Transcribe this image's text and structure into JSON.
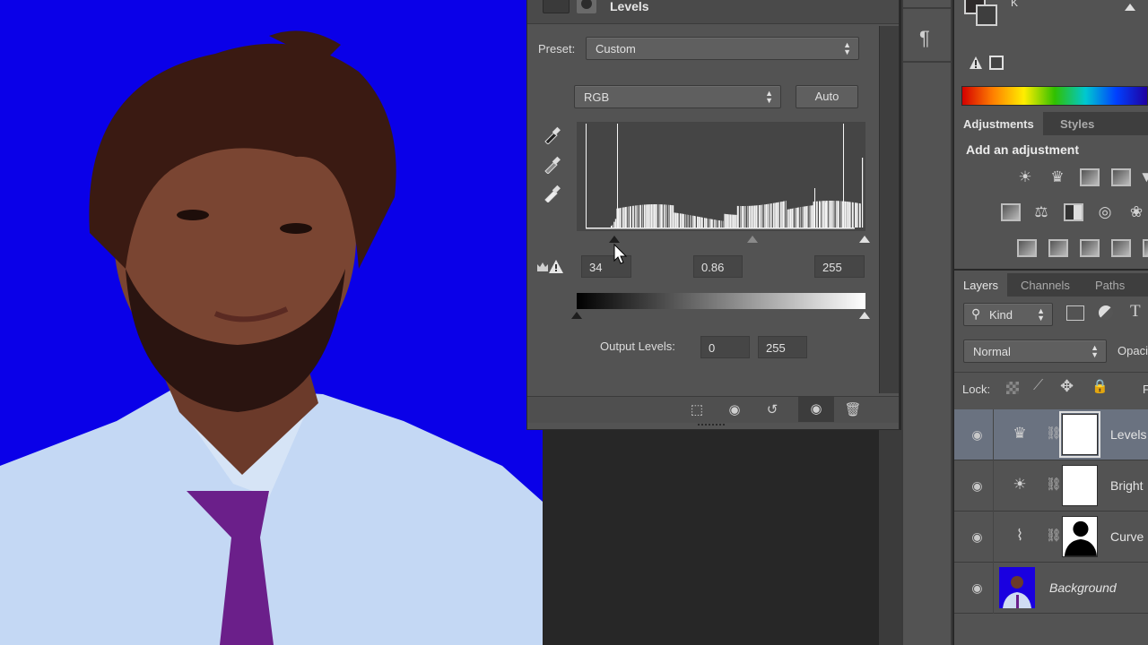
{
  "canvas": {
    "background_color": "#0a00e8",
    "subject": "portrait of bearded man in light blue shirt and purple tie"
  },
  "levels_panel": {
    "title": "Levels",
    "preset_label": "Preset:",
    "preset_value": "Custom",
    "channel_value": "RGB",
    "auto_label": "Auto",
    "input_black": "34",
    "input_gamma": "0.86",
    "input_white": "255",
    "output_label": "Output Levels:",
    "output_black": "0",
    "output_white": "255",
    "footer_icons": [
      "clip-to-layer-icon",
      "view-previous-state-icon",
      "reset-icon",
      "visibility-eye-icon",
      "delete-trash-icon"
    ]
  },
  "color_panel": {
    "k_label": "K"
  },
  "adjustments_panel": {
    "tabs": [
      {
        "label": "Adjustments"
      },
      {
        "label": "Styles"
      }
    ],
    "heading": "Add an adjustment",
    "row1": [
      "brightness-contrast-icon",
      "levels-icon",
      "curves-icon",
      "exposure-icon"
    ],
    "row2": [
      "hue-saturation-icon",
      "color-balance-icon",
      "black-white-icon",
      "photo-filter-icon",
      "channel-mixer-icon"
    ],
    "row3": [
      "invert-icon",
      "posterize-icon",
      "threshold-icon",
      "selective-color-icon"
    ]
  },
  "layers_panel": {
    "tabs": [
      {
        "label": "Layers"
      },
      {
        "label": "Channels"
      },
      {
        "label": "Paths"
      }
    ],
    "filter_value": "Kind",
    "blend_mode": "Normal",
    "opacity_label": "Opaci",
    "lock_label": "Lock:",
    "fill_label": "F",
    "layers": [
      {
        "name": "Levels",
        "type": "levels",
        "selected": true
      },
      {
        "name": "Bright",
        "type": "brightness",
        "selected": false
      },
      {
        "name": "Curve",
        "type": "curves",
        "selected": false
      },
      {
        "name": "Background",
        "type": "image",
        "selected": false
      }
    ]
  }
}
